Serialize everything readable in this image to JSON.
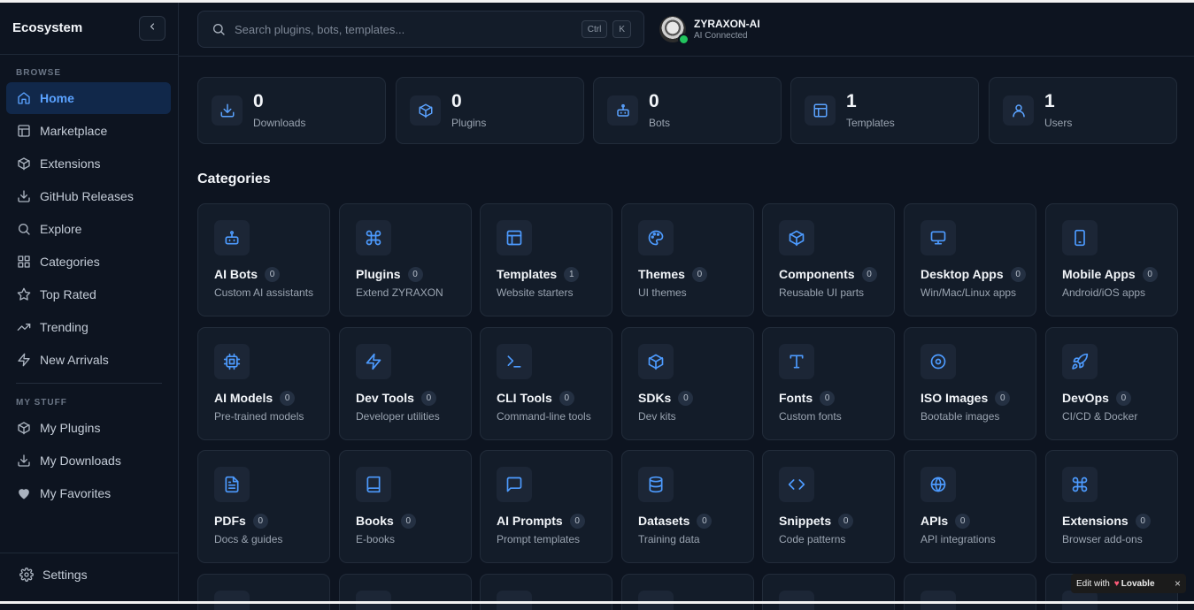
{
  "sidebar": {
    "brand": "Ecosystem",
    "browse_label": "BROWSE",
    "browse_items": [
      {
        "label": "Home",
        "icon": "home-icon",
        "active": true
      },
      {
        "label": "Marketplace",
        "icon": "marketplace-icon"
      },
      {
        "label": "Extensions",
        "icon": "package-icon"
      },
      {
        "label": "GitHub Releases",
        "icon": "download-icon"
      },
      {
        "label": "Explore",
        "icon": "search-icon"
      },
      {
        "label": "Categories",
        "icon": "grid-icon"
      },
      {
        "label": "Top Rated",
        "icon": "star-icon"
      },
      {
        "label": "Trending",
        "icon": "trending-icon"
      },
      {
        "label": "New Arrivals",
        "icon": "zap-icon"
      }
    ],
    "mystuff_label": "MY STUFF",
    "mystuff_items": [
      {
        "label": "My Plugins",
        "icon": "package-icon"
      },
      {
        "label": "My Downloads",
        "icon": "download-icon"
      },
      {
        "label": "My Favorites",
        "icon": "heart-icon"
      }
    ],
    "settings_label": "Settings"
  },
  "header": {
    "search_placeholder": "Search plugins, bots, templates...",
    "kbd_ctrl": "Ctrl",
    "kbd_k": "K",
    "user_name": "ZYRAXON-AI",
    "user_status": "AI Connected"
  },
  "stats": [
    {
      "value": "0",
      "label": "Downloads",
      "icon": "download-icon"
    },
    {
      "value": "0",
      "label": "Plugins",
      "icon": "package-icon"
    },
    {
      "value": "0",
      "label": "Bots",
      "icon": "bot-icon"
    },
    {
      "value": "1",
      "label": "Templates",
      "icon": "layout-icon"
    },
    {
      "value": "1",
      "label": "Users",
      "icon": "user-icon"
    }
  ],
  "categories_title": "Categories",
  "categories": [
    {
      "name": "AI Bots",
      "count": "0",
      "desc": "Custom AI assistants",
      "icon": "bot-icon"
    },
    {
      "name": "Plugins",
      "count": "0",
      "desc": "Extend ZYRAXON",
      "icon": "command-icon"
    },
    {
      "name": "Templates",
      "count": "1",
      "desc": "Website starters",
      "icon": "layout-icon"
    },
    {
      "name": "Themes",
      "count": "0",
      "desc": "UI themes",
      "icon": "palette-icon"
    },
    {
      "name": "Components",
      "count": "0",
      "desc": "Reusable UI parts",
      "icon": "package-icon"
    },
    {
      "name": "Desktop Apps",
      "count": "0",
      "desc": "Win/Mac/Linux apps",
      "icon": "monitor-icon"
    },
    {
      "name": "Mobile Apps",
      "count": "0",
      "desc": "Android/iOS apps",
      "icon": "smartphone-icon"
    },
    {
      "name": "AI Models",
      "count": "0",
      "desc": "Pre-trained models",
      "icon": "cpu-icon"
    },
    {
      "name": "Dev Tools",
      "count": "0",
      "desc": "Developer utilities",
      "icon": "zap-icon"
    },
    {
      "name": "CLI Tools",
      "count": "0",
      "desc": "Command-line tools",
      "icon": "terminal-icon"
    },
    {
      "name": "SDKs",
      "count": "0",
      "desc": "Dev kits",
      "icon": "package-icon"
    },
    {
      "name": "Fonts",
      "count": "0",
      "desc": "Custom fonts",
      "icon": "type-icon"
    },
    {
      "name": "ISO Images",
      "count": "0",
      "desc": "Bootable images",
      "icon": "disc-icon"
    },
    {
      "name": "DevOps",
      "count": "0",
      "desc": "CI/CD & Docker",
      "icon": "rocket-icon"
    },
    {
      "name": "PDFs",
      "count": "0",
      "desc": "Docs & guides",
      "icon": "file-text-icon"
    },
    {
      "name": "Books",
      "count": "0",
      "desc": "E-books",
      "icon": "book-icon"
    },
    {
      "name": "AI Prompts",
      "count": "0",
      "desc": "Prompt templates",
      "icon": "message-icon"
    },
    {
      "name": "Datasets",
      "count": "0",
      "desc": "Training data",
      "icon": "database-icon"
    },
    {
      "name": "Snippets",
      "count": "0",
      "desc": "Code patterns",
      "icon": "code-icon"
    },
    {
      "name": "APIs",
      "count": "0",
      "desc": "API integrations",
      "icon": "globe-icon"
    },
    {
      "name": "Extensions",
      "count": "0",
      "desc": "Browser add-ons",
      "icon": "command-icon"
    }
  ],
  "badge": {
    "prefix": "Edit with",
    "brand": "Lovable",
    "close": "×"
  },
  "colors": {
    "accent": "#4d9bff",
    "background": "#0d1420",
    "card": "#131c29",
    "active_nav": "#11284a",
    "online": "#22c55e"
  }
}
